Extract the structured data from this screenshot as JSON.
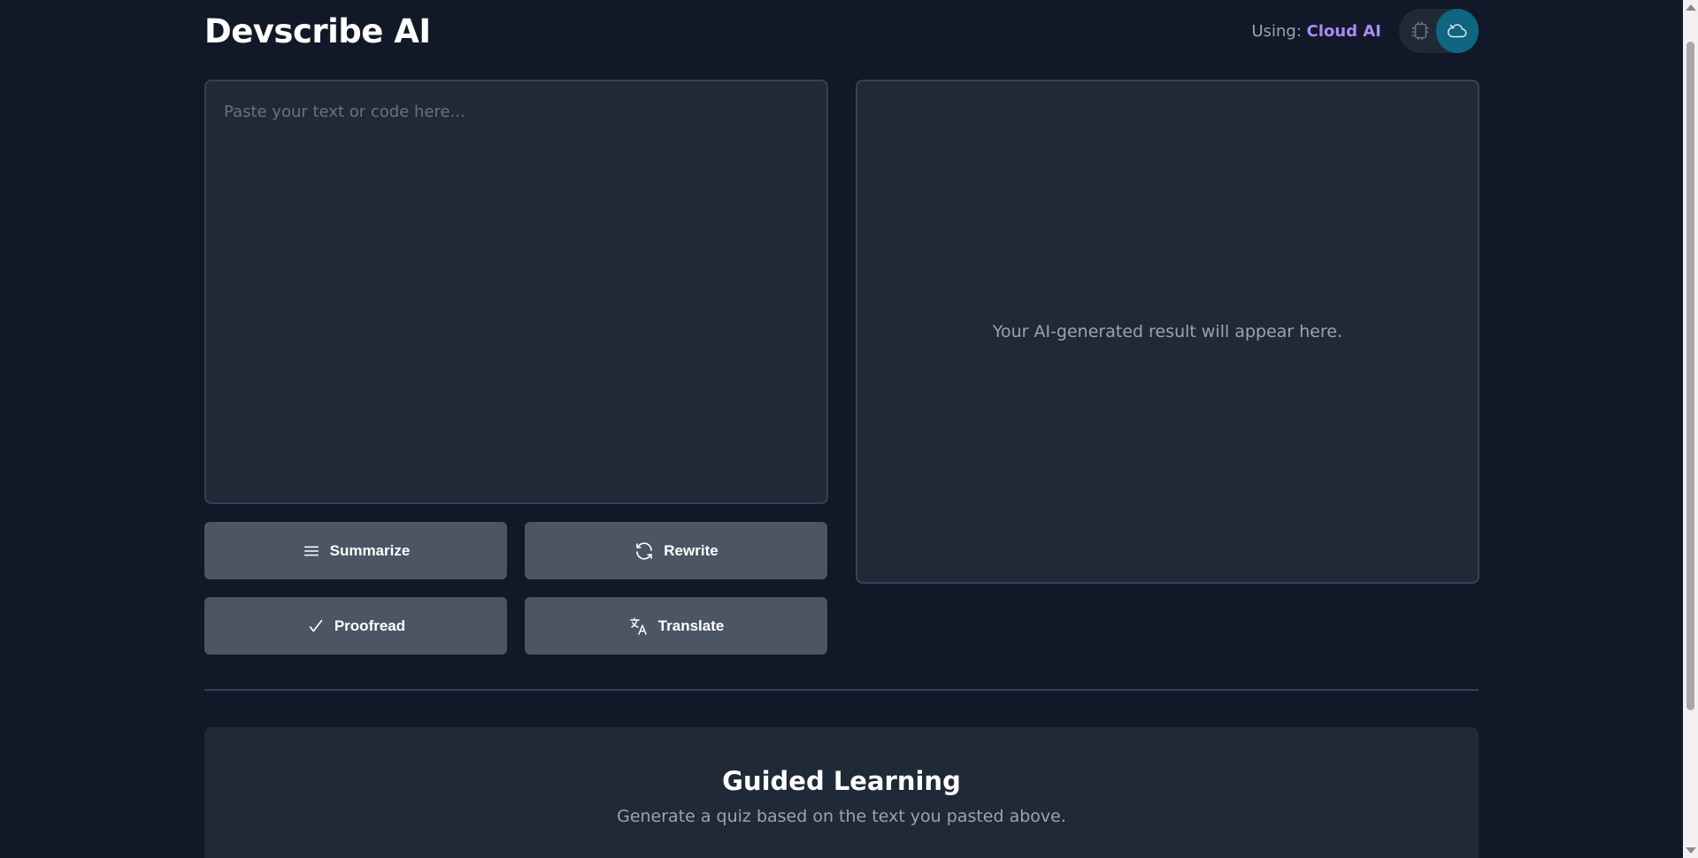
{
  "header": {
    "title": "Devscribe AI",
    "status_prefix": "Using:",
    "engine_name": "Cloud AI",
    "toggle_options": [
      {
        "name": "local-ai",
        "icon": "chip-icon",
        "active": false
      },
      {
        "name": "cloud-ai",
        "icon": "cloud-icon",
        "active": true
      }
    ]
  },
  "editor": {
    "placeholder": "Paste your text or code here...",
    "value": ""
  },
  "output": {
    "placeholder": "Your AI-generated result will appear here."
  },
  "actions": {
    "summarize": {
      "label": "Summarize",
      "icon": "lines-icon"
    },
    "rewrite": {
      "label": "Rewrite",
      "icon": "refresh-icon"
    },
    "proofread": {
      "label": "Proofread",
      "icon": "check-icon"
    },
    "translate": {
      "label": "Translate",
      "icon": "translate-icon"
    }
  },
  "learning": {
    "title": "Guided Learning",
    "subtitle": "Generate a quiz based on the text you pasted above."
  },
  "colors": {
    "background": "#111827",
    "panel": "#1f2937",
    "button": "#4b5563",
    "accent": "#a78bfa",
    "toggle_active": "#0e6680"
  }
}
